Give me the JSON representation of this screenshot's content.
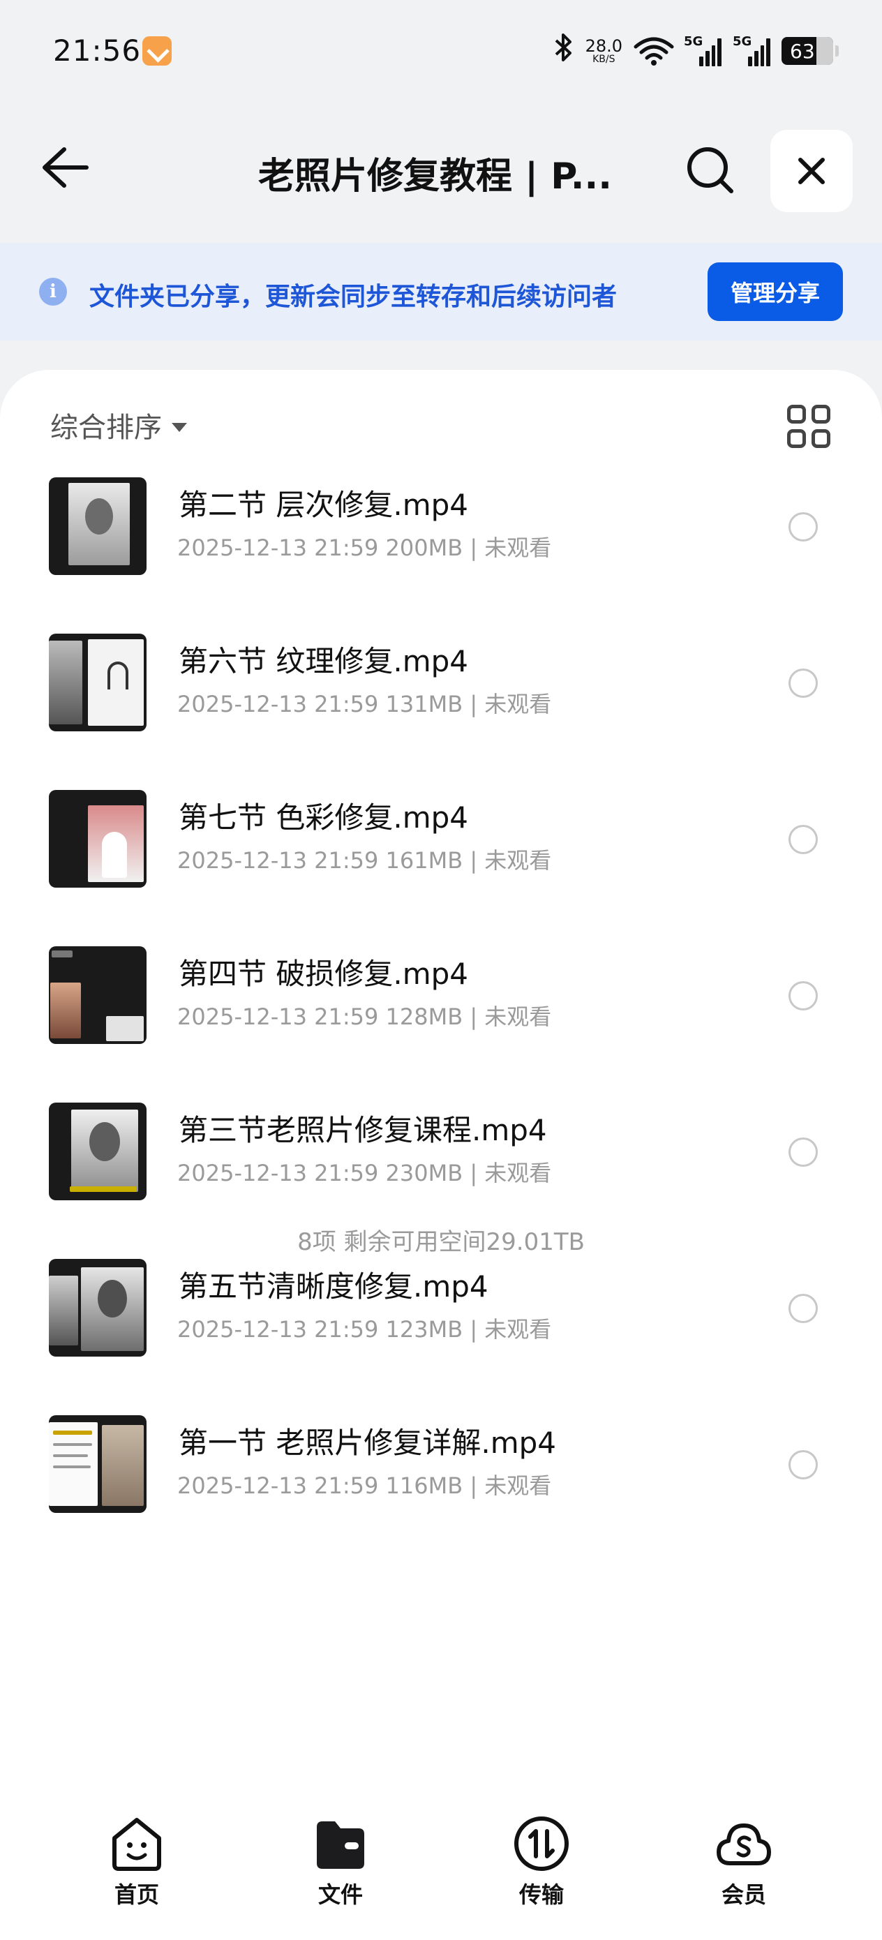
{
  "status_bar": {
    "time": "21:56",
    "net_speed": "28.0",
    "net_speed_unit": "KB/S",
    "signal_1": "5G",
    "signal_2": "5G",
    "battery": "63"
  },
  "header": {
    "title": "老照片修复教程 | P..."
  },
  "banner": {
    "text": "文件夹已分享，更新会同步至转存和后续访问者",
    "button": "管理分享"
  },
  "toolbar": {
    "sort_label": "综合排序"
  },
  "files": [
    {
      "name": "第二节 层次修复.mp4",
      "meta": "2025-12-13 21:59  200MB | 未观看"
    },
    {
      "name": "第六节 纹理修复.mp4",
      "meta": "2025-12-13 21:59  131MB | 未观看"
    },
    {
      "name": "第七节 色彩修复.mp4",
      "meta": "2025-12-13 21:59  161MB | 未观看"
    },
    {
      "name": "第四节 破损修复.mp4",
      "meta": "2025-12-13 21:59  128MB | 未观看"
    },
    {
      "name": "第三节老照片修复课程.mp4",
      "meta": "2025-12-13 21:59  230MB | 未观看"
    },
    {
      "name": "第五节清晰度修复.mp4",
      "meta": "2025-12-13 21:59  123MB | 未观看"
    },
    {
      "name": "第一节 老照片修复详解.mp4",
      "meta": "2025-12-13 21:59  116MB | 未观看"
    }
  ],
  "summary": "8项 剩余可用空间29.01TB",
  "nav": [
    {
      "label": "首页",
      "icon": "home-face-icon"
    },
    {
      "label": "文件",
      "icon": "folder-icon"
    },
    {
      "label": "传输",
      "icon": "transfer-icon"
    },
    {
      "label": "会员",
      "icon": "member-cloud-icon"
    }
  ],
  "colors": {
    "accent": "#0a5be5",
    "banner_bg": "#e8eefa",
    "banner_text": "#1e56d8"
  }
}
